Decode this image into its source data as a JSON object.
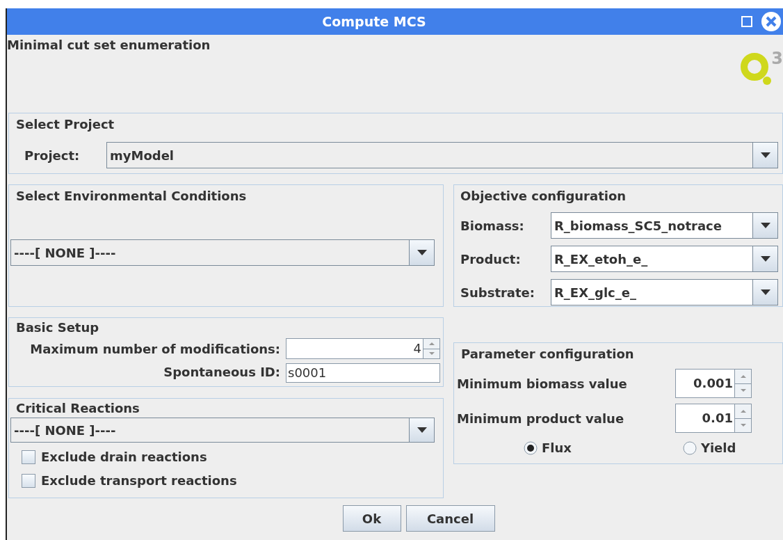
{
  "window": {
    "title": "Compute MCS",
    "header": "Minimal cut set enumeration",
    "logo_text": "3"
  },
  "project_panel": {
    "title": "Select Project",
    "label": "Project:",
    "value": "myModel"
  },
  "environment_panel": {
    "title": "Select Environmental Conditions",
    "value": "----[ NONE ]----"
  },
  "basic_setup": {
    "title": "Basic Setup",
    "fields": [
      {
        "kind": "spinner",
        "label": "Maximum number of modifications:",
        "value": "4"
      },
      {
        "kind": "text",
        "label": "Spontaneous ID:",
        "value": "s0001"
      }
    ]
  },
  "critical_reactions": {
    "title": "Critical Reactions",
    "value": "----[ NONE ]----",
    "options": [
      {
        "label": "Exclude drain reactions",
        "checked": false
      },
      {
        "label": "Exclude transport reactions",
        "checked": false
      }
    ]
  },
  "objective": {
    "title": "Objective configuration",
    "rows": [
      {
        "label": "Biomass:",
        "value": "R_biomass_SC5_notrace"
      },
      {
        "label": "Product:",
        "value": "R_EX_etoh_e_"
      },
      {
        "label": "Substrate:",
        "value": "R_EX_glc_e_"
      }
    ]
  },
  "parameters": {
    "title": "Parameter configuration",
    "rows": [
      {
        "label": "Minimum biomass value",
        "value": "0.001"
      },
      {
        "label": "Minimum product value",
        "value": "0.01"
      }
    ],
    "modes": [
      {
        "label": "Flux",
        "selected": true
      },
      {
        "label": "Yield",
        "selected": false
      }
    ]
  },
  "buttons": [
    "Ok",
    "Cancel"
  ]
}
